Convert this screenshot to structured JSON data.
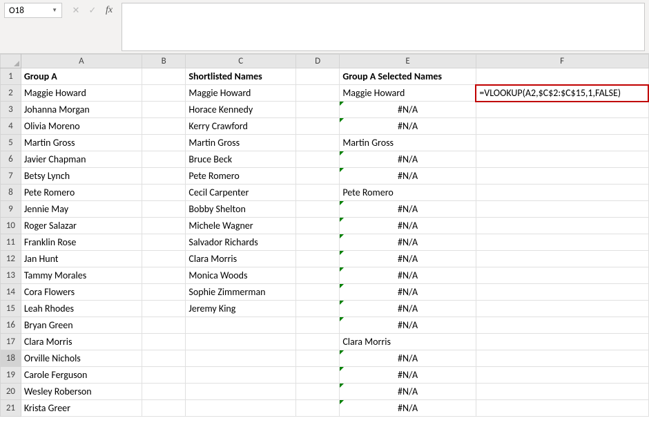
{
  "nameBox": "O18",
  "formulaBar": "",
  "columns": [
    "A",
    "B",
    "C",
    "D",
    "E",
    "F"
  ],
  "highlightedFormula": "=VLOOKUP(A2,$C$2:$C$15,1,FALSE)",
  "rows": [
    {
      "n": 1,
      "A": "Group A",
      "C": "Shortlisted Names",
      "E": "Group A Selected Names",
      "bold": true
    },
    {
      "n": 2,
      "A": "Maggie Howard",
      "C": "Maggie Howard",
      "E": "Maggie Howard",
      "F_formula": true
    },
    {
      "n": 3,
      "A": "Johanna Morgan",
      "C": "Horace Kennedy",
      "E": "#N/A",
      "err": true
    },
    {
      "n": 4,
      "A": "Olivia Moreno",
      "C": "Kerry Crawford",
      "E": "#N/A",
      "err": true
    },
    {
      "n": 5,
      "A": "Martin Gross",
      "C": "Martin Gross",
      "E": "Martin Gross"
    },
    {
      "n": 6,
      "A": "Javier Chapman",
      "C": "Bruce Beck",
      "E": "#N/A",
      "err": true
    },
    {
      "n": 7,
      "A": "Betsy Lynch",
      "C": "Pete Romero",
      "E": "#N/A",
      "err": true
    },
    {
      "n": 8,
      "A": "Pete Romero",
      "C": "Cecil Carpenter",
      "E": "Pete Romero"
    },
    {
      "n": 9,
      "A": "Jennie May",
      "C": "Bobby Shelton",
      "E": "#N/A",
      "err": true
    },
    {
      "n": 10,
      "A": "Roger Salazar",
      "C": "Michele Wagner",
      "E": "#N/A",
      "err": true
    },
    {
      "n": 11,
      "A": "Franklin Rose",
      "C": "Salvador Richards",
      "E": "#N/A",
      "err": true
    },
    {
      "n": 12,
      "A": "Jan Hunt",
      "C": "Clara Morris",
      "E": "#N/A",
      "err": true
    },
    {
      "n": 13,
      "A": "Tammy Morales",
      "C": "Monica Woods",
      "E": "#N/A",
      "err": true
    },
    {
      "n": 14,
      "A": "Cora Flowers",
      "C": "Sophie Zimmerman",
      "E": "#N/A",
      "err": true
    },
    {
      "n": 15,
      "A": "Leah Rhodes",
      "C": "Jeremy King",
      "E": "#N/A",
      "err": true
    },
    {
      "n": 16,
      "A": "Bryan Green",
      "C": "",
      "E": "#N/A",
      "err": true
    },
    {
      "n": 17,
      "A": "Clara Morris",
      "C": "",
      "E": "Clara Morris"
    },
    {
      "n": 18,
      "A": "Orville Nichols",
      "C": "",
      "E": "#N/A",
      "err": true,
      "rowSel": true
    },
    {
      "n": 19,
      "A": "Carole Ferguson",
      "C": "",
      "E": "#N/A",
      "err": true
    },
    {
      "n": 20,
      "A": "Wesley Roberson",
      "C": "",
      "E": "#N/A",
      "err": true
    },
    {
      "n": 21,
      "A": "Krista Greer",
      "C": "",
      "E": "#N/A",
      "err": true
    }
  ]
}
